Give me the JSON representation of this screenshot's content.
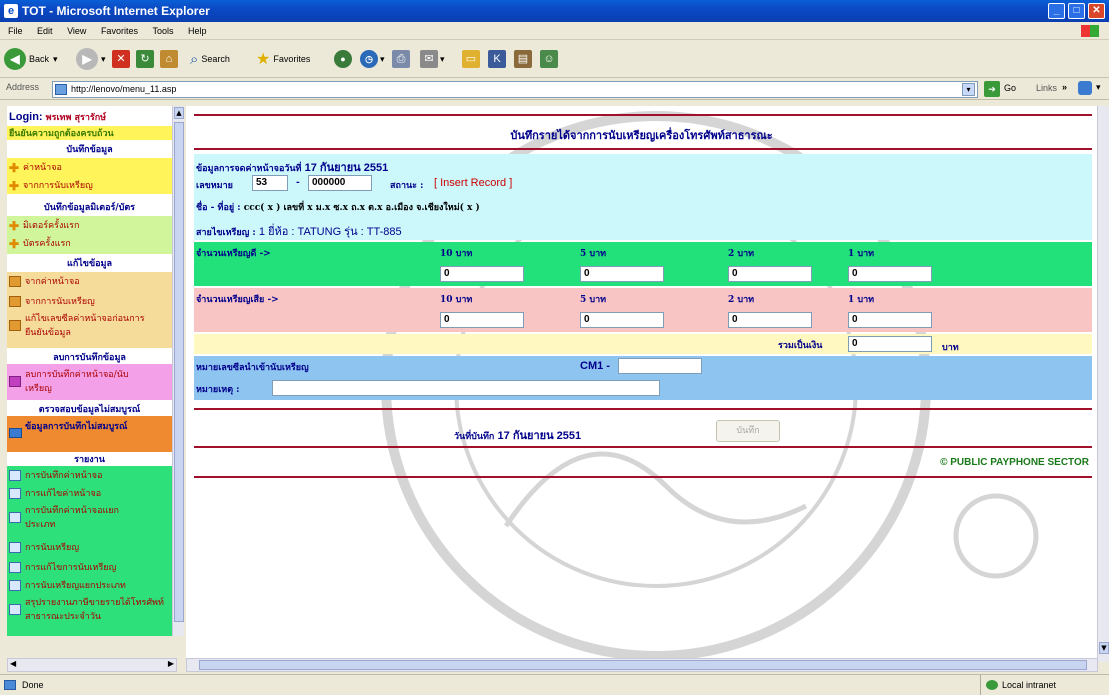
{
  "window": {
    "title": "TOT - Microsoft Internet Explorer"
  },
  "menubar": [
    "File",
    "Edit",
    "View",
    "Favorites",
    "Tools",
    "Help"
  ],
  "toolbar": {
    "back": "Back",
    "search": "Search",
    "favorites": "Favorites"
  },
  "address": {
    "label": "Address",
    "url": "http://lenovo/menu_11.asp",
    "go": "Go",
    "links": "Links"
  },
  "sidebar": {
    "login_label": "Login:",
    "login_user": "พรเทพ สุรารักษ์",
    "confirm_title": "ยืนยันความถูกต้องครบถ้วน",
    "sections": [
      {
        "title": "บันทึกข้อมูล",
        "items": [
          "ค่าหน้าจอ",
          "จากการนับเหรียญ"
        ]
      },
      {
        "title": "บันทึกข้อมูลมิเตอร์/บัตร",
        "items": [
          "มิเตอร์ครั้งแรก",
          "บัตรครั้งแรก"
        ]
      },
      {
        "title": "แก้ไขข้อมูล",
        "items": [
          "จากค่าหน้าจอ",
          "จากการนับเหรียญ",
          "แก้ไขเลขซีลค่าหน้าจอก่อนการยืนยันข้อมูล"
        ]
      },
      {
        "title": "ลบการบันทึกข้อมูล",
        "items": [
          "ลบการบันทึกค่าหน้าจอ/นับเหรียญ"
        ]
      },
      {
        "title": "ตรวจสอบข้อมูลไม่สมบูรณ์",
        "items": [
          "ข้อมูลการบันทึกไม่สมบูรณ์"
        ]
      },
      {
        "title": "รายงาน",
        "items": [
          "การบันทึกค่าหน้าจอ",
          "การแก้ไขค่าหน้าจอ",
          "การบันทึกค่าหน้าจอแยกประเภท",
          "การนับเหรียญ",
          "การแก้ไขการนับเหรียญ",
          "การนับเหรียญแยกประเภท",
          "สรุปรายงานภาษีขายรายได้โทรศัพท์สาธารณะประจำวัน"
        ]
      }
    ]
  },
  "form": {
    "heading": "บันทึกรายได้จากการนับเหรียญเครื่องโทรศัพท์สาธารณะ",
    "record_line_prefix": "ข้อมูลการจดค่าหน้าจอวันที่",
    "record_date": "17 กันยายน 2551",
    "number_label": "เลขหมาย",
    "number_prefix": "53",
    "number_dash": "-",
    "number_value": "000000",
    "status_label": "สถานะ :",
    "status_value": "[ Insert Record ]",
    "address_label": "ชื่อ - ที่อยู่ :",
    "address_value": "ccc( x ) เลขที่ x ม.x ซ.x ถ.x ต.x อ.เมือง จ.เชียงใหม่( x )",
    "line_label": "สายไขเหรียญ :",
    "line_value": "1 ยี่ห้อ : TATUNG รุ่น : TT-885",
    "good_coins_label": "จำนวนเหรียญดี ->",
    "bad_coins_label": "จำนวนเหรียญเสีย ->",
    "denominations": [
      "10 บาท",
      "5 บาท",
      "2 บาท",
      "1 บาท"
    ],
    "good_values": [
      "0",
      "0",
      "0",
      "0"
    ],
    "bad_values": [
      "0",
      "0",
      "0",
      "0"
    ],
    "total_label": "รวมเป็นเงิน",
    "total_value": "0",
    "total_unit": "บาท",
    "seal_label": "หมายเลขซีลนำเข้านับเหรียญ",
    "cm_label": "CM1 -",
    "cm_value": "",
    "remark_label": "หมายเหตุ :",
    "remark_value": "",
    "save_date_label": "วันที่บันทึก",
    "save_date": "17 กันยายน 2551",
    "save_button": "บันทึก",
    "footer": "© PUBLIC PAYPHONE SECTOR"
  },
  "status": {
    "left": "Done",
    "right": "Local intranet"
  }
}
